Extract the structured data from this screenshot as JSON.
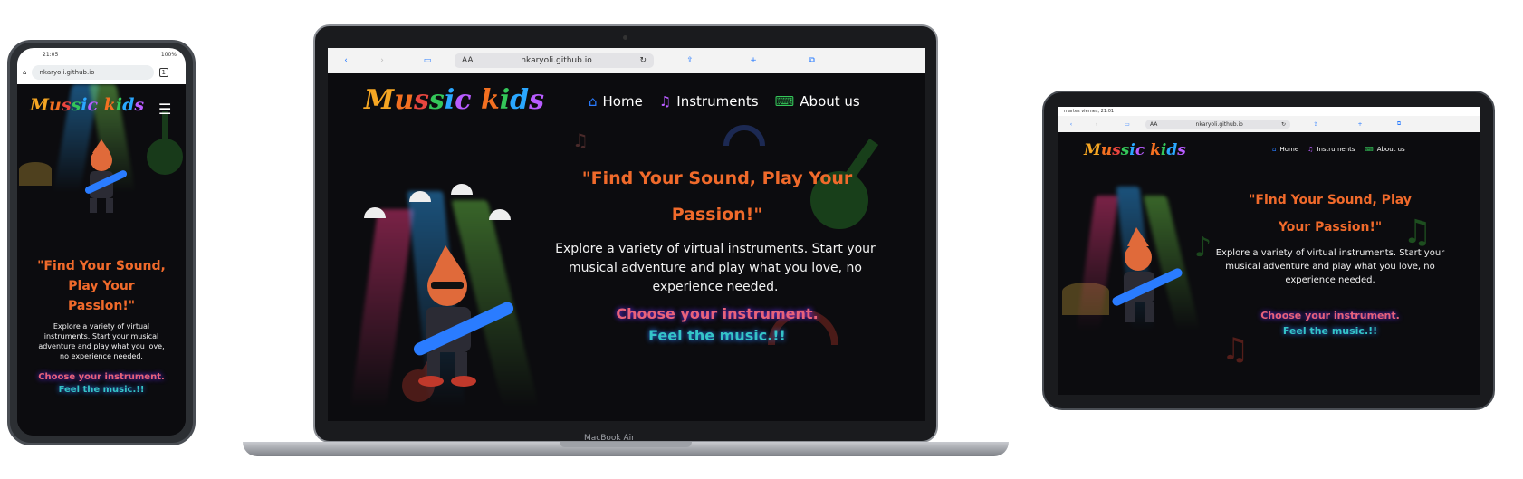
{
  "site": {
    "logo_parts": [
      "M",
      "u",
      "s",
      "s",
      "i",
      "c",
      " ",
      "k",
      "i",
      "d",
      "s"
    ],
    "headline_line1": "\"Find Your Sound, Play Your",
    "headline_line2": "Passion!\"",
    "phone_headline_line1": "\"Find Your Sound,",
    "phone_headline_line2": "Play Your",
    "phone_headline_line3": "Passion!\"",
    "tablet_headline_line1": "\"Find Your Sound, Play",
    "tablet_headline_line2": "Your Passion!\"",
    "description": "Explore a variety of virtual instruments. Start your musical adventure and play what you love, no experience needed.",
    "cta_line1": "Choose your instrument.",
    "cta_line2": "Feel the music.!!",
    "nav": [
      {
        "label": "Home",
        "icon": "home-icon"
      },
      {
        "label": "Instruments",
        "icon": "music-note-icon"
      },
      {
        "label": "About us",
        "icon": "keyboard-icon"
      }
    ]
  },
  "phone": {
    "time": "21:05",
    "battery": "100%",
    "url": "nkaryoli.github.io",
    "tab_count": "1"
  },
  "laptop": {
    "url_prefix": "AA",
    "url": "nkaryoli.github.io",
    "model_label": "MacBook Air"
  },
  "tablet": {
    "status": "martes viernes, 21:01",
    "url_prefix": "AA",
    "url": "nkaryoli.github.io"
  },
  "colors": {
    "background": "#0c0c0f",
    "headline": "#f06a2b",
    "cta_pink": "#e8627a",
    "cta_teal": "#35c4c8",
    "browser_accent": "#2a7cff"
  }
}
